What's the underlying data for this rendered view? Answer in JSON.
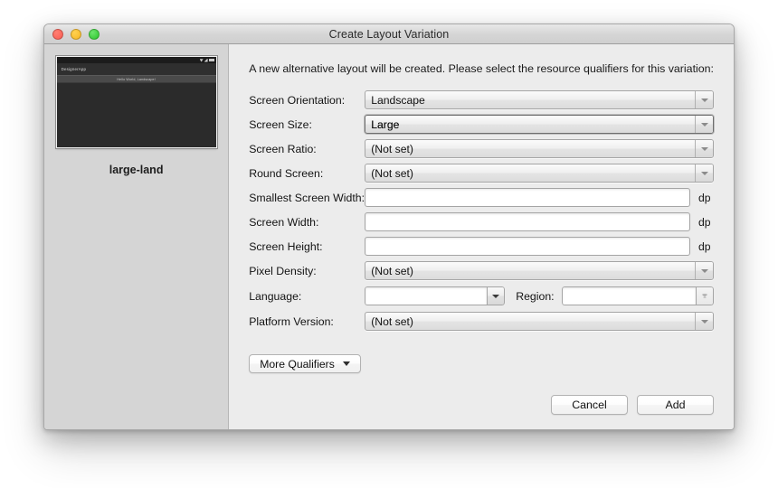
{
  "window": {
    "title": "Create Layout Variation",
    "traffic_lights": [
      "close-button",
      "minimize-button",
      "maximize-button"
    ]
  },
  "preview": {
    "caption": "large-land",
    "device_app_name": "DesignerApp",
    "device_banner_text": "Hello World, Landscape!",
    "status_icons": [
      "wifi-icon",
      "signal-icon",
      "battery-icon"
    ]
  },
  "form": {
    "intro": "A new alternative layout will be created. Please select the resource qualifiers for this variation:",
    "not_set": "(Not set)",
    "unit_dp": "dp",
    "rows": [
      {
        "label": "Screen Orientation:",
        "value": "Landscape",
        "type": "dropdown",
        "focused": false
      },
      {
        "label": "Screen Size:",
        "value": "Large",
        "type": "dropdown",
        "focused": true
      },
      {
        "label": "Screen Ratio:",
        "value": "(Not set)",
        "type": "dropdown",
        "focused": false
      },
      {
        "label": "Round Screen:",
        "value": "(Not set)",
        "type": "dropdown",
        "focused": false
      },
      {
        "label": "Smallest Screen Width:",
        "value": "",
        "type": "text",
        "unit": "dp"
      },
      {
        "label": "Screen Width:",
        "value": "",
        "type": "text",
        "unit": "dp"
      },
      {
        "label": "Screen Height:",
        "value": "",
        "type": "text",
        "unit": "dp"
      },
      {
        "label": "Pixel Density:",
        "value": "(Not set)",
        "type": "dropdown",
        "focused": false
      }
    ],
    "language_row": {
      "label": "Language:",
      "language_value": "",
      "region_label": "Region:",
      "region_value": ""
    },
    "platform_row": {
      "label": "Platform Version:",
      "value": "(Not set)"
    }
  },
  "buttons": {
    "more_qualifiers": "More Qualifiers",
    "cancel": "Cancel",
    "add": "Add"
  }
}
